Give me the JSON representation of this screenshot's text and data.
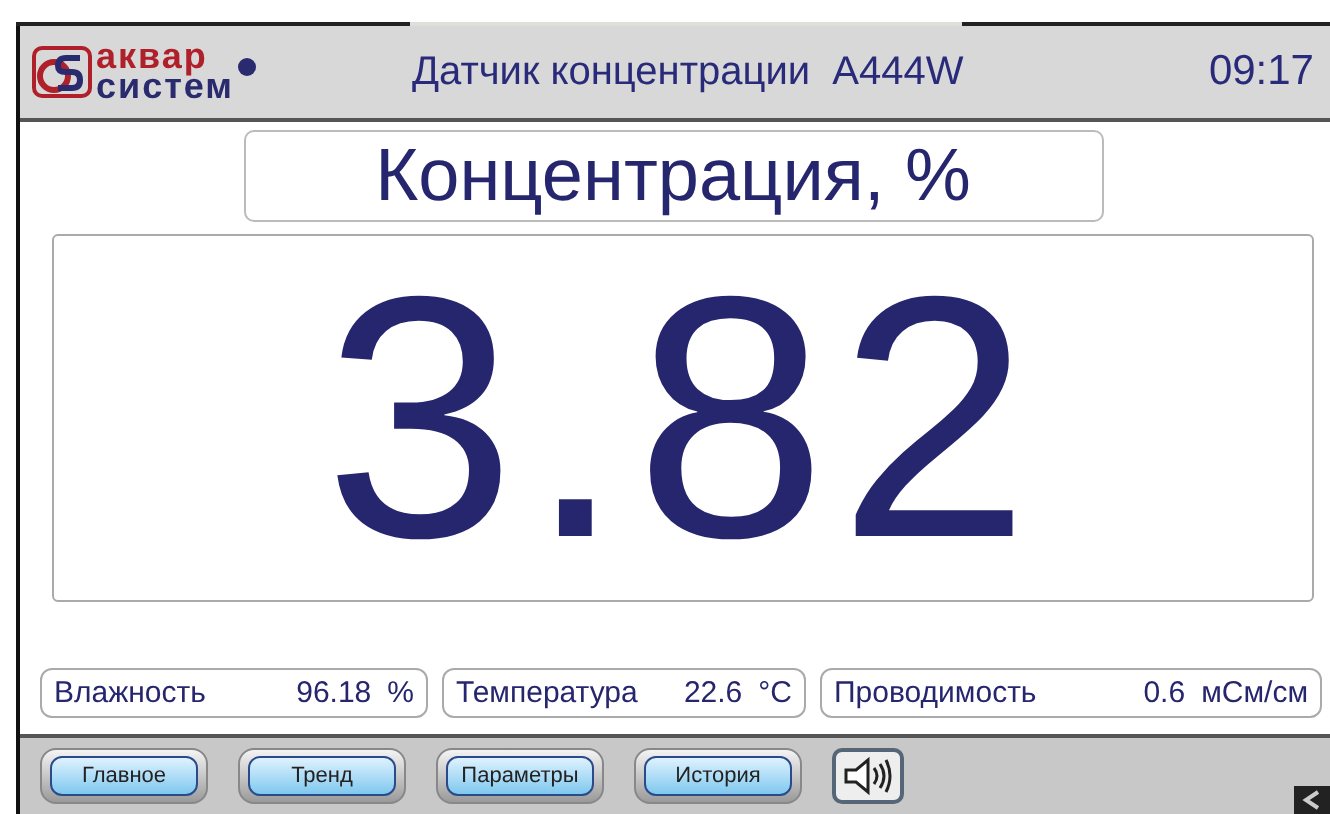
{
  "header": {
    "logo_top": "аквар",
    "logo_bottom": "систем",
    "title": "Датчик концентрации  A444W",
    "time": "09:17"
  },
  "measurement": {
    "label": "Концентрация, %",
    "value": "3.82"
  },
  "readings": [
    {
      "name": "Влажность",
      "value": "96.18",
      "unit": "%"
    },
    {
      "name": "Температура",
      "value": "22.6",
      "unit": "°C"
    },
    {
      "name": "Проводимость",
      "value": "0.6",
      "unit": "мСм/см"
    }
  ],
  "nav_buttons": [
    "Главное",
    "Тренд",
    "Параметры",
    "История"
  ]
}
